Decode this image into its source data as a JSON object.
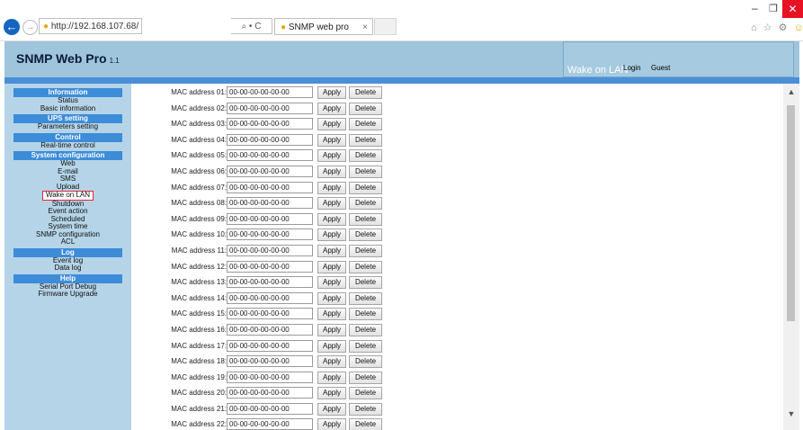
{
  "browser": {
    "url": "http://192.168.107.68/",
    "search_glyph": "⌕ • C",
    "tab_title": "SNMP web pro",
    "tab_close": "×",
    "icons": [
      "home-icon",
      "star-icon",
      "gear-icon",
      "smiley-icon"
    ]
  },
  "header": {
    "logo": "SNMP Web Pro",
    "version": "1.1",
    "page_caption": "Wake on LAN",
    "login_label": "Login",
    "user": "Guest"
  },
  "sidebar": {
    "sections": [
      {
        "title": "Information",
        "items": [
          "Status",
          "Basic information"
        ]
      },
      {
        "title": "UPS setting",
        "items": [
          "Parameters setting"
        ]
      },
      {
        "title": "Control",
        "items": [
          "Real-time control"
        ]
      },
      {
        "title": "System configuration",
        "items": [
          "Web",
          "E-mail",
          "SMS",
          "Upload",
          "Wake on LAN",
          "Shutdown",
          "Event action",
          "Scheduled",
          "System time",
          "SNMP configuration",
          "ACL"
        ]
      },
      {
        "title": "Log",
        "items": [
          "Event log",
          "Data log"
        ]
      },
      {
        "title": "Help",
        "items": [
          "Serial Port Debug",
          "Firmware Upgrade"
        ]
      }
    ],
    "active_item": "Wake on LAN"
  },
  "mac_list": {
    "apply_label": "Apply",
    "delete_label": "Delete",
    "rows": [
      {
        "label": "MAC address 01:",
        "value": "00-00-00-00-00-00"
      },
      {
        "label": "MAC address 02:",
        "value": "00-00-00-00-00-00"
      },
      {
        "label": "MAC address 03:",
        "value": "00-00-00-00-00-00"
      },
      {
        "label": "MAC address 04:",
        "value": "00-00-00-00-00-00"
      },
      {
        "label": "MAC address 05:",
        "value": "00-00-00-00-00-00"
      },
      {
        "label": "MAC address 06:",
        "value": "00-00-00-00-00-00"
      },
      {
        "label": "MAC address 07:",
        "value": "00-00-00-00-00-00"
      },
      {
        "label": "MAC address 08:",
        "value": "00-00-00-00-00-00"
      },
      {
        "label": "MAC address 09:",
        "value": "00-00-00-00-00-00"
      },
      {
        "label": "MAC address 10:",
        "value": "00-00-00-00-00-00"
      },
      {
        "label": "MAC address 11:",
        "value": "00-00-00-00-00-00"
      },
      {
        "label": "MAC address 12:",
        "value": "00-00-00-00-00-00"
      },
      {
        "label": "MAC address 13:",
        "value": "00-00-00-00-00-00"
      },
      {
        "label": "MAC address 14:",
        "value": "00-00-00-00-00-00"
      },
      {
        "label": "MAC address 15:",
        "value": "00-00-00-00-00-00"
      },
      {
        "label": "MAC address 16:",
        "value": "00-00-00-00-00-00"
      },
      {
        "label": "MAC address 17:",
        "value": "00-00-00-00-00-00"
      },
      {
        "label": "MAC address 18:",
        "value": "00-00-00-00-00-00"
      },
      {
        "label": "MAC address 19:",
        "value": "00-00-00-00-00-00"
      },
      {
        "label": "MAC address 20:",
        "value": "00-00-00-00-00-00"
      },
      {
        "label": "MAC address 21:",
        "value": "00-00-00-00-00-00"
      },
      {
        "label": "MAC address 22:",
        "value": "00-00-00-00-00-00"
      }
    ]
  },
  "colors": {
    "page_bg": "#9ec5dc",
    "nav_header": "#3d8cd8",
    "band": "#4a8fd8",
    "active_border": "#e0263c",
    "close_button": "#e81123"
  }
}
